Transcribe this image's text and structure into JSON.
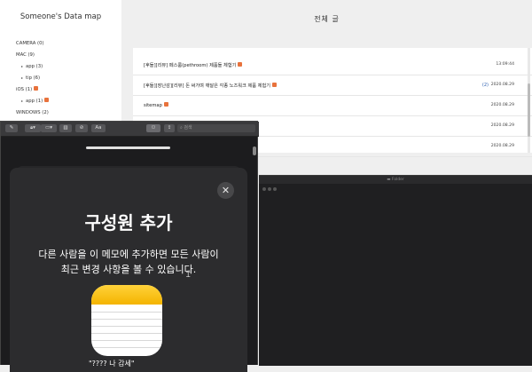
{
  "blog": {
    "title": "Someone's Data map",
    "heading": "전체 글",
    "categories": [
      {
        "label": "CAMERA (0)"
      },
      {
        "label": "MAC (9)"
      },
      {
        "label": "app (3)"
      },
      {
        "label": "tip (6)"
      },
      {
        "label": "iOS (1)"
      },
      {
        "label": "app (1)"
      },
      {
        "label": "WINDOWS (2)"
      }
    ],
    "posts": [
      {
        "title": "[후들][리뷰] 페스룸(pethroom) 제품들 체험기",
        "date": "13:09:44",
        "count": ""
      },
      {
        "title": "[후들][장난감][리뷰] 돈 써가며 깨달은 각종 노즈워크 제품 체험기",
        "date": "2020.08.29",
        "count": "(2)"
      },
      {
        "title": "sitemap",
        "date": "2020.08.29",
        "count": ""
      },
      {
        "title": "",
        "date": "2020.08.29",
        "count": ""
      },
      {
        "title": "",
        "date": "2020.08.29",
        "count": ""
      }
    ]
  },
  "notes_window": {
    "toolbar": {
      "font_button": "Aa",
      "search_placeholder": "검색"
    },
    "sheet": {
      "close_symbol": "✕",
      "title": "구성원 추가",
      "description_line1": "다른 사람을 이 메모에 추가하면 모든 사람이",
      "description_line2": "최근 변경 사항을 볼 수 있습니다.",
      "bottom_text": "\"???? 나 감세\""
    },
    "icons": [
      "compose-icon",
      "lock-icon",
      "gallery-icon",
      "table-icon",
      "checklist-icon",
      "collaborate-icon",
      "share-icon",
      "search-icon",
      "notes-app-icon",
      "close-icon"
    ]
  },
  "dark_window": {
    "title": "Folder"
  },
  "colors": {
    "new_badge": "#e8723c",
    "notes_yellow": "#f4b400",
    "dark_bg": "#1c1c1e"
  }
}
